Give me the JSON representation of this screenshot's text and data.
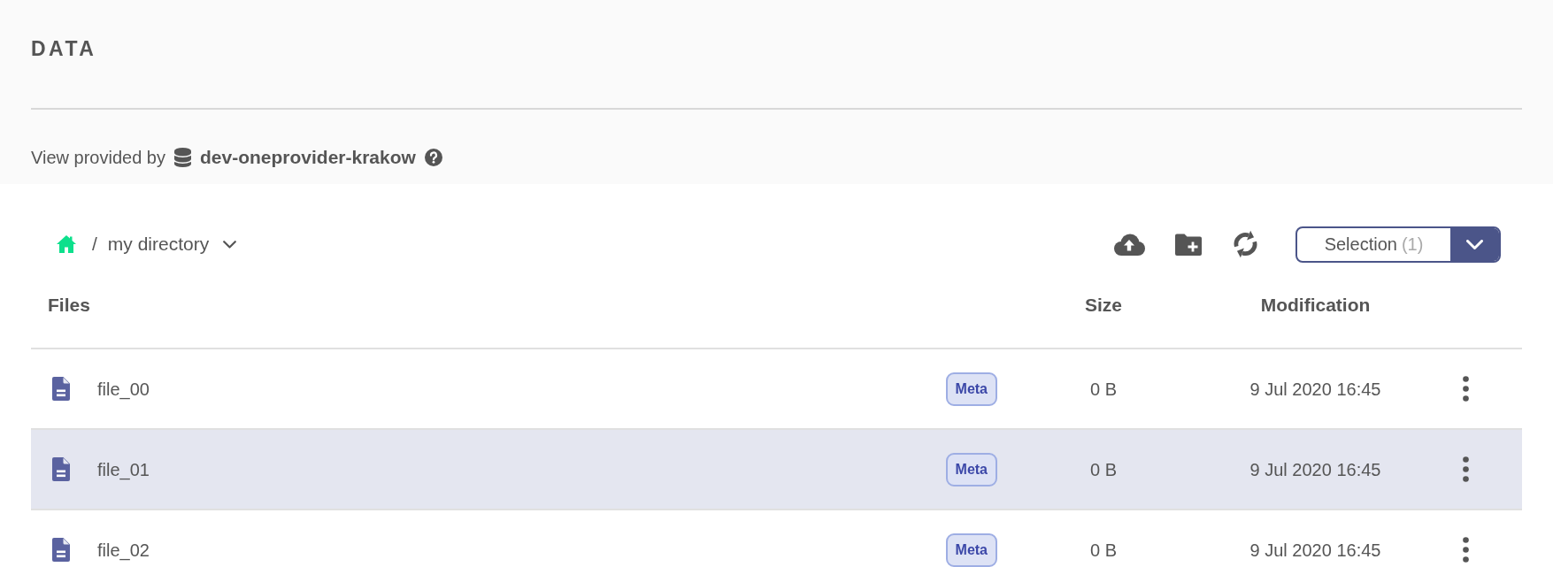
{
  "header": {
    "title": "DATA",
    "provider_label": "View provided by",
    "provider_name": "dev-oneprovider-krakow"
  },
  "breadcrumb": {
    "separator": "/",
    "current": "my directory"
  },
  "toolbar": {
    "selection_label": "Selection",
    "selection_count": "(1)"
  },
  "table": {
    "columns": [
      "Files",
      "Size",
      "Modification"
    ],
    "rows": [
      {
        "name": "file_00",
        "badge": "Meta",
        "size": "0 B",
        "modified": "9 Jul 2020 16:45",
        "selected": false
      },
      {
        "name": "file_01",
        "badge": "Meta",
        "size": "0 B",
        "modified": "9 Jul 2020 16:45",
        "selected": true
      },
      {
        "name": "file_02",
        "badge": "Meta",
        "size": "0 B",
        "modified": "9 Jul 2020 16:45",
        "selected": false
      }
    ]
  }
}
